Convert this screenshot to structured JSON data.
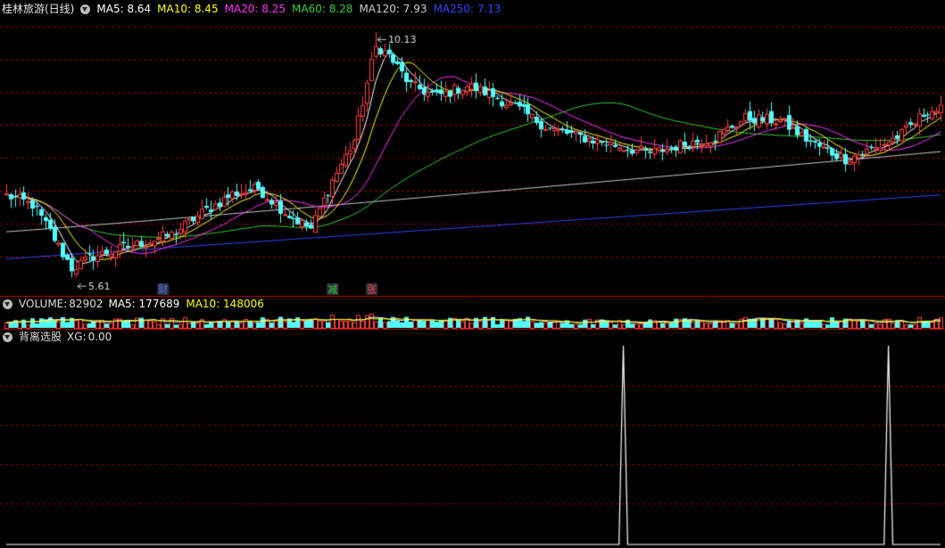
{
  "header": {
    "stock_name": "桂林旅游(日线)",
    "mas": [
      {
        "label": "MA5:",
        "value": "8.64",
        "color": "#ffffff"
      },
      {
        "label": "MA10:",
        "value": "8.45",
        "color": "#ffff00"
      },
      {
        "label": "MA20:",
        "value": "8.25",
        "color": "#ff33ff"
      },
      {
        "label": "MA60:",
        "value": "8.28",
        "color": "#33cc33"
      },
      {
        "label": "MA120:",
        "value": "7.93",
        "color": "#cccccc"
      },
      {
        "label": "MA250:",
        "value": "7.13",
        "color": "#3344ff"
      }
    ]
  },
  "volume_header": {
    "title": "VOLUME:",
    "value": "82902",
    "mas": [
      {
        "label": "MA5:",
        "value": "177689",
        "color": "#ffffff"
      },
      {
        "label": "MA10:",
        "value": "148006",
        "color": "#ffff00"
      }
    ]
  },
  "indicator_header": {
    "title": "背离选股",
    "label": "XG:",
    "value": "0.00"
  },
  "colors": {
    "up": "#ff4040",
    "down": "#54ffff",
    "grid": "#8b0000",
    "ma5": "#ffffff",
    "ma10": "#ffff00",
    "ma20": "#ff33ff",
    "ma60": "#33cc33",
    "ma120": "#cccccc",
    "ma250": "#3344ff",
    "xg": "#ffffff"
  },
  "chart_data": [
    {
      "type": "candlestick",
      "title": "桂林旅游(日线)",
      "ylim": [
        5.3,
        10.4
      ],
      "annotations": [
        {
          "label": "10.13",
          "kind": "high",
          "bar": 85,
          "value": 10.13
        },
        {
          "label": "5.61",
          "kind": "low",
          "bar": 16,
          "value": 5.61
        }
      ],
      "event_markers": [
        {
          "label": "财",
          "bar": 36,
          "color": "#4d79ff"
        },
        {
          "label": "减",
          "bar": 75,
          "color": "#33cc33"
        },
        {
          "label": "张",
          "bar": 84,
          "color": "#ff4040"
        }
      ],
      "anchors_close": [
        [
          0,
          7.12
        ],
        [
          6,
          6.95
        ],
        [
          10,
          6.45
        ],
        [
          15,
          5.78
        ],
        [
          20,
          6.0
        ],
        [
          30,
          6.22
        ],
        [
          38,
          6.4
        ],
        [
          45,
          6.8
        ],
        [
          52,
          7.15
        ],
        [
          58,
          7.25
        ],
        [
          65,
          6.75
        ],
        [
          70,
          6.5
        ],
        [
          75,
          7.4
        ],
        [
          80,
          8.15
        ],
        [
          85,
          9.9
        ],
        [
          88,
          9.7
        ],
        [
          93,
          9.15
        ],
        [
          99,
          8.95
        ],
        [
          106,
          9.15
        ],
        [
          111,
          9.0
        ],
        [
          117,
          8.75
        ],
        [
          125,
          8.35
        ],
        [
          132,
          8.2
        ],
        [
          140,
          8.05
        ],
        [
          148,
          7.9
        ],
        [
          155,
          8.05
        ],
        [
          163,
          8.2
        ],
        [
          170,
          8.55
        ],
        [
          178,
          8.5
        ],
        [
          186,
          8.05
        ],
        [
          193,
          7.8
        ],
        [
          200,
          8.0
        ],
        [
          206,
          8.25
        ],
        [
          212,
          8.7
        ],
        [
          215,
          8.7
        ]
      ]
    },
    {
      "type": "bar",
      "title": "VOLUME",
      "series_name": "VOLUME",
      "last_value": 82902,
      "ma5": 177689,
      "ma10": 148006
    },
    {
      "type": "line",
      "title": "背离选股",
      "series_name": "XG",
      "last_value": 0,
      "ylim": [
        0,
        1
      ],
      "signals_at_bar": [
        142,
        203
      ]
    }
  ]
}
